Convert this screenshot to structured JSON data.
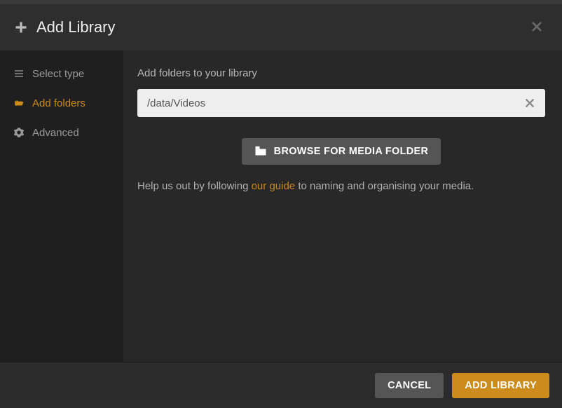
{
  "header": {
    "title": "Add Library"
  },
  "sidebar": {
    "items": [
      {
        "label": "Select type"
      },
      {
        "label": "Add folders"
      },
      {
        "label": "Advanced"
      }
    ]
  },
  "main": {
    "section_label": "Add folders to your library",
    "path_value": "/data/Videos",
    "browse_label": "BROWSE FOR MEDIA FOLDER",
    "help_pre": "Help us out by following ",
    "help_link": "our guide",
    "help_post": " to naming and organising your media."
  },
  "footer": {
    "cancel": "CANCEL",
    "submit": "ADD LIBRARY"
  }
}
